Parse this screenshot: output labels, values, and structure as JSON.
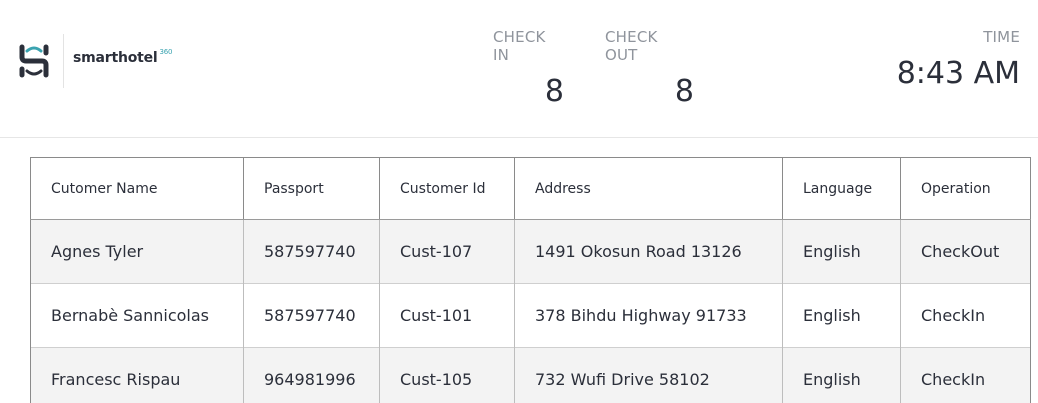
{
  "brand": {
    "name": "smarthotel",
    "superscript": "360",
    "accent_color": "#3aa3b0",
    "logo_color": "#2b2f3a"
  },
  "stats": {
    "checkin_label": "CHECK IN",
    "checkin_value": "8",
    "checkout_label": "CHECK OUT",
    "checkout_value": "8",
    "time_label": "TIME",
    "time_value": "8:43 AM"
  },
  "table": {
    "headers": [
      "Cutomer Name",
      "Passport",
      "Customer Id",
      "Address",
      "Language",
      "Operation"
    ],
    "rows": [
      [
        "Agnes Tyler",
        "587597740",
        "Cust-107",
        "1491 Okosun Road 13126",
        "English",
        "CheckOut"
      ],
      [
        "Bernabè Sannicolas",
        "587597740",
        "Cust-101",
        "378 Bihdu Highway 91733",
        "English",
        "CheckIn"
      ],
      [
        "Francesc Rispau",
        "964981996",
        "Cust-105",
        "732 Wufi Drive 58102",
        "English",
        "CheckIn"
      ]
    ]
  }
}
